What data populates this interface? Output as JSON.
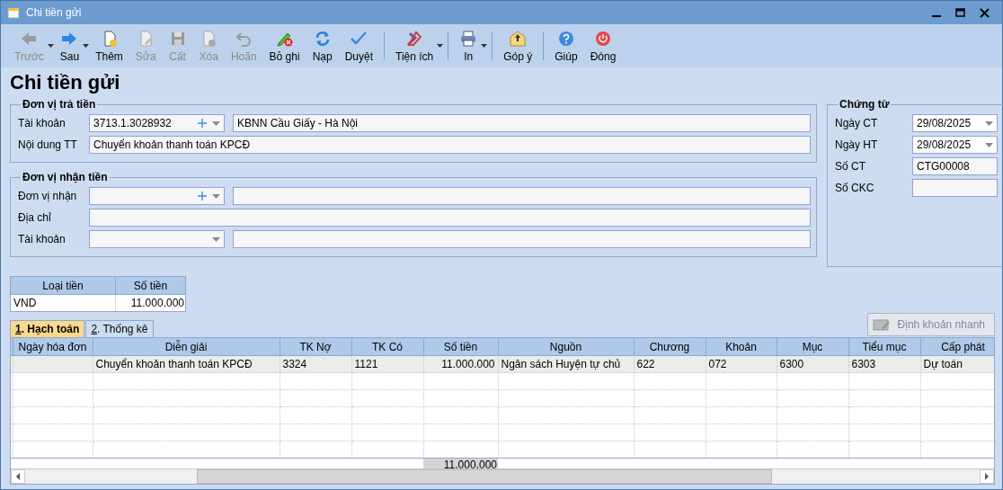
{
  "window": {
    "title": "Chi tiền gửi"
  },
  "toolbar": [
    {
      "label": "Trước",
      "disabled": true,
      "has_menu": true
    },
    {
      "label": "Sau",
      "disabled": false,
      "has_menu": true
    },
    {
      "label": "Thêm",
      "disabled": false,
      "has_menu": false
    },
    {
      "label": "Sửa",
      "disabled": true,
      "has_menu": false
    },
    {
      "label": "Cất",
      "disabled": true,
      "has_menu": false
    },
    {
      "label": "Xóa",
      "disabled": true,
      "has_menu": false
    },
    {
      "label": "Hoãn",
      "disabled": true,
      "has_menu": false
    },
    {
      "label": "Bỏ ghi",
      "disabled": false,
      "has_menu": false
    },
    {
      "label": "Nạp",
      "disabled": false,
      "has_menu": false
    },
    {
      "label": "Duyệt",
      "disabled": false,
      "has_menu": false
    },
    {
      "label": "Tiện ích",
      "disabled": false,
      "has_menu": true
    },
    {
      "label": "In",
      "disabled": false,
      "has_menu": true
    },
    {
      "label": "Góp ý",
      "disabled": false,
      "has_menu": false
    },
    {
      "label": "Giúp",
      "disabled": false,
      "has_menu": false
    },
    {
      "label": "Đóng",
      "disabled": false,
      "has_menu": false
    }
  ],
  "heading": "Chi tiền gửi",
  "payer": {
    "title": "Đơn vị trả tiền",
    "rows": [
      {
        "label": "Tài khoản",
        "kind": "lookup",
        "code": "3713.1.3028932",
        "name": "KBNN Cầu Giấy - Hà Nội"
      },
      {
        "label": "Nội dung TT",
        "kind": "text",
        "value": "Chuyển khoản thanh toán KPCĐ"
      }
    ]
  },
  "payee": {
    "title": "Đơn vị nhận tiền",
    "rows": [
      {
        "label": "Đơn vị nhận",
        "kind": "lookup"
      },
      {
        "label": "Địa chỉ",
        "kind": "text"
      },
      {
        "label": "Tài khoản",
        "kind": "select"
      }
    ]
  },
  "voucher": {
    "title": "Chứng từ",
    "rows": [
      {
        "label": "Ngày CT",
        "kind": "date",
        "value": "29/08/2025"
      },
      {
        "label": "Ngày HT",
        "kind": "date",
        "value": "29/08/2025"
      },
      {
        "label": "Số CT",
        "kind": "text",
        "value": "CTG00008"
      },
      {
        "label": "Số CKC",
        "kind": "text"
      }
    ]
  },
  "currency_table": {
    "columns": [
      "Loại tiền",
      "Số tiền"
    ],
    "rows": [
      [
        "VND",
        "11.000.000"
      ]
    ]
  },
  "tabs": [
    {
      "label": "1. Hạch toán",
      "selected": true
    },
    {
      "label": "2. Thống kê",
      "selected": false
    }
  ],
  "quick_entry_button": {
    "label": "Định khoản nhanh",
    "disabled": true
  },
  "grid": {
    "columns": [
      {
        "label": "Ngày hóa đơn"
      },
      {
        "label": "Diễn giải"
      },
      {
        "label": "TK Nợ"
      },
      {
        "label": "TK Có"
      },
      {
        "label": "Số tiền"
      },
      {
        "label": "Nguồn"
      },
      {
        "label": "Chương"
      },
      {
        "label": "Khoản"
      },
      {
        "label": "Mục"
      },
      {
        "label": "Tiểu mục"
      },
      {
        "label": "Cấp phát"
      }
    ],
    "rows": [
      {
        "selected": true,
        "cells": [
          null,
          "Chuyển khoản thanh toán KPCĐ",
          "3324",
          "1121",
          "11.000.000",
          "Ngân sách Huyện tự chủ",
          "622",
          "072",
          "6300",
          "6303",
          "Dự toán"
        ]
      }
    ],
    "footer": {
      "amount_total": "11.000.000"
    }
  }
}
